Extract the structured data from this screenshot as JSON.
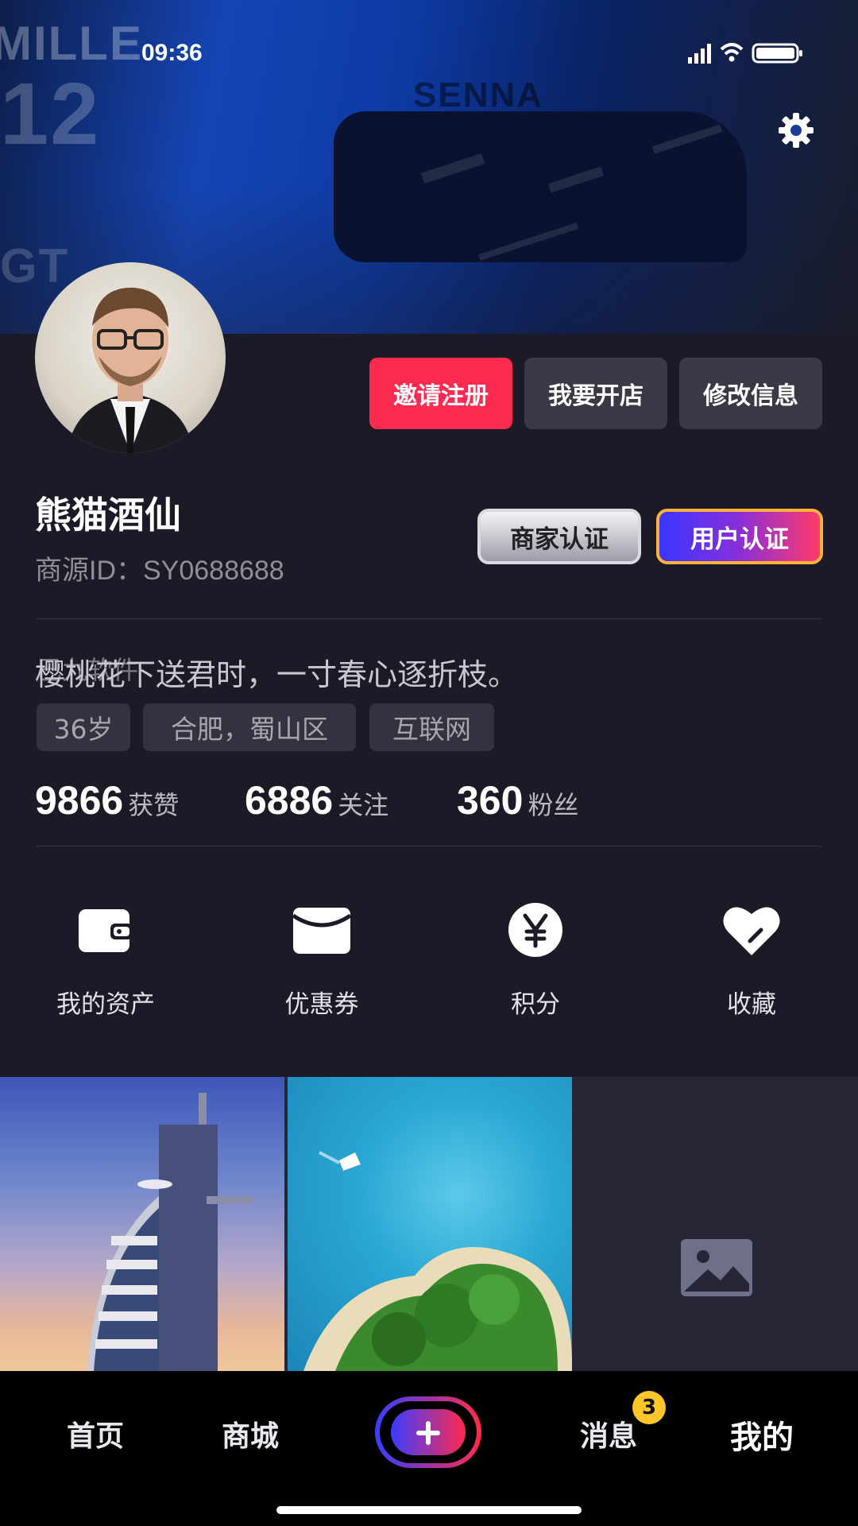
{
  "status_bar": {
    "time": "09:36"
  },
  "cover": {
    "words": [
      "MILLE",
      "12",
      "SENNA",
      "GT"
    ]
  },
  "header": {
    "buttons": {
      "invite": "邀请注册",
      "open_shop": "我要开店",
      "edit_info": "修改信息"
    }
  },
  "profile": {
    "name": "熊猫酒仙",
    "id_text": "商源ID：SY0688688",
    "certs": {
      "merchant": "商家认证",
      "user": "用户认证"
    },
    "bio": "樱桃花下送君时，一寸春心逐折枝。",
    "watermark": "巴九软件",
    "tags": [
      "36岁",
      "合肥，蜀山区",
      "互联网"
    ]
  },
  "stats": [
    {
      "value": "9866",
      "label": "获赞"
    },
    {
      "value": "6886",
      "label": "关注"
    },
    {
      "value": "360",
      "label": "粉丝"
    }
  ],
  "quick_actions": [
    {
      "label": "我的资产",
      "icon": "wallet-icon"
    },
    {
      "label": "优惠券",
      "icon": "coupon-icon"
    },
    {
      "label": "积分",
      "icon": "yen-icon"
    },
    {
      "label": "收藏",
      "icon": "heart-icon"
    }
  ],
  "gallery": {
    "photos": [
      "burj-al-arab-photo",
      "island-aerial-photo",
      "image-placeholder-icon"
    ]
  },
  "tabbar": {
    "items": {
      "home": "首页",
      "mall": "商城",
      "messages": "消息",
      "mine": "我的"
    },
    "message_badge": "3",
    "active": "我的"
  },
  "colors": {
    "background": "#1b1a26",
    "accent_red": "#ff2a4f",
    "button_gray": "#3a3945",
    "badge_yellow": "#ffc629"
  }
}
